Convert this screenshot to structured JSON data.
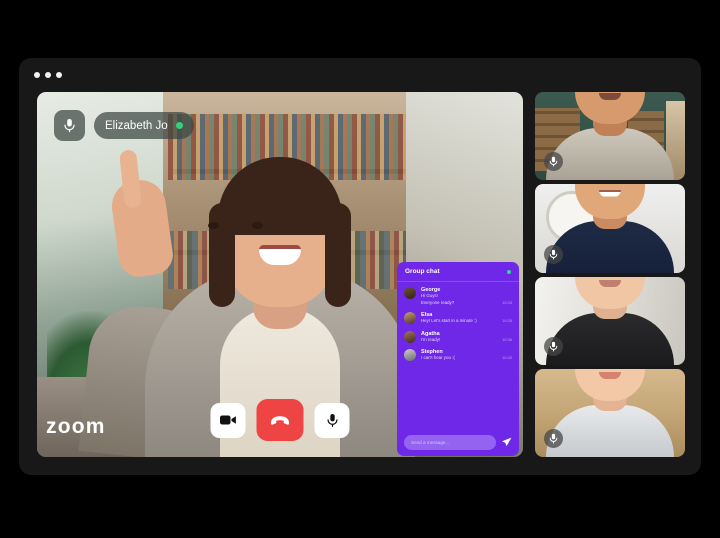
{
  "app": {
    "name": "Zoom",
    "wordmark": "zoom"
  },
  "window": {
    "dots_count": 3
  },
  "speaker": {
    "name": "Elizabeth Jo",
    "mic_icon": "microphone-icon",
    "status": "online",
    "status_color": "#2fd37a"
  },
  "controls": {
    "video_label": "video-camera",
    "end_call_label": "end-call",
    "mic_label": "microphone",
    "end_call_color": "#ef4444"
  },
  "chat": {
    "title": "Group chat",
    "online_indicator_color": "#25e08a",
    "panel_color": "#7028e8",
    "messages": [
      {
        "name": "George",
        "line1": "Hi Guys!",
        "line2": "Everyone ready?",
        "time": "10:33"
      },
      {
        "name": "Elsa",
        "line1": "Hey! Let's start in a minute :)",
        "line2": "",
        "time": "10:35"
      },
      {
        "name": "Agatha",
        "line1": "I'm ready!",
        "line2": "",
        "time": "10:36"
      },
      {
        "name": "Stephen",
        "line1": "I can't hear you :(",
        "line2": "",
        "time": "10:40"
      }
    ],
    "composer": {
      "placeholder": "Send a message...",
      "value": "",
      "send_icon": "send-paper-plane-icon"
    }
  },
  "participants": [
    {
      "id": "participant-1",
      "mic_icon": "microphone-icon"
    },
    {
      "id": "participant-2",
      "mic_icon": "microphone-icon"
    },
    {
      "id": "participant-3",
      "mic_icon": "microphone-icon"
    },
    {
      "id": "participant-4",
      "mic_icon": "microphone-icon"
    }
  ]
}
